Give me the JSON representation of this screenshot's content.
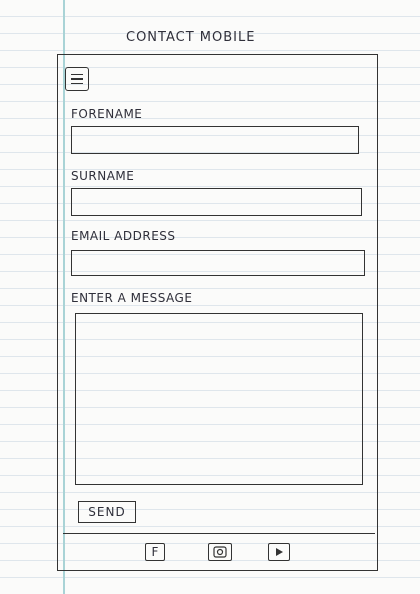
{
  "header": {
    "title": "CONTACT   MOBILE"
  },
  "toolbar": {
    "menu_icon": "hamburger-icon"
  },
  "form": {
    "forename_label": "FORENAME",
    "surname_label": "SURNAME",
    "email_label": "EMAIL ADDRESS",
    "message_label": "ENTER A MESSAGE",
    "send_label": "SEND"
  },
  "footer": {
    "icons": [
      "facebook-icon",
      "instagram-icon",
      "youtube-icon"
    ],
    "facebook_glyph": "F"
  }
}
